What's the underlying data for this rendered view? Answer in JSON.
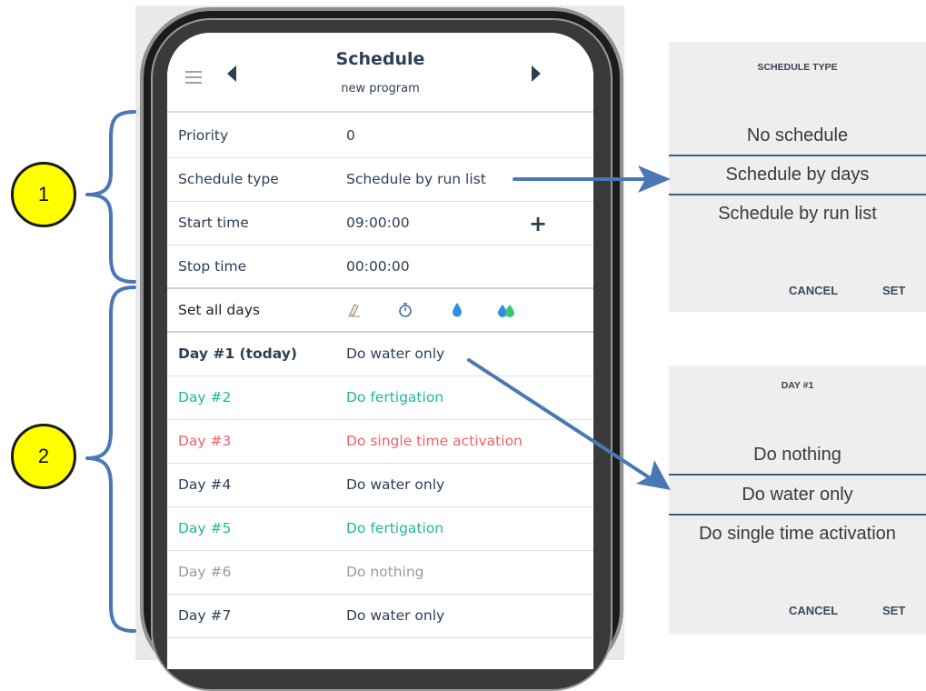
{
  "phone": {
    "header": {
      "title": "Schedule",
      "subtitle": "new program"
    },
    "settings": [
      {
        "label": "Priority",
        "value": "0"
      },
      {
        "label": "Schedule type",
        "value": "Schedule by run list"
      },
      {
        "label": "Start time",
        "value": "09:00:00",
        "action_icon": "plus-icon"
      },
      {
        "label": "Stop time",
        "value": "00:00:00"
      }
    ],
    "set_all_days": {
      "label": "Set all days",
      "icons": [
        "eraser-icon",
        "stopwatch-icon",
        "water-drop-icon",
        "fertigation-drops-icon"
      ]
    },
    "days": [
      {
        "label": "Day #1 (today)",
        "value": "Do water only",
        "color": "#2d3f55"
      },
      {
        "label": "Day #2",
        "value": "Do fertigation",
        "color": "#1fb89a"
      },
      {
        "label": "Day #3",
        "value": "Do single time activation",
        "color": "#f0606a"
      },
      {
        "label": "Day #4",
        "value": "Do water only",
        "color": "#2d3f55"
      },
      {
        "label": "Day #5",
        "value": "Do fertigation",
        "color": "#1fb89a"
      },
      {
        "label": "Day #6",
        "value": "Do nothing",
        "color": "#9a9a9a"
      },
      {
        "label": "Day #7",
        "value": "Do water only",
        "color": "#2d3f55"
      }
    ]
  },
  "schedule_type_dialog": {
    "title": "SCHEDULE TYPE",
    "options": [
      "No schedule",
      "Schedule by days",
      "Schedule by run list"
    ],
    "selected": "Schedule by days",
    "cancel_label": "CANCEL",
    "set_label": "SET"
  },
  "day_dialog": {
    "title": "DAY #1",
    "options": [
      "Do nothing",
      "Do water only",
      "Do single time activation"
    ],
    "selected": "Do water only",
    "cancel_label": "CANCEL",
    "set_label": "SET"
  },
  "callouts": [
    {
      "number": "1"
    },
    {
      "number": "2"
    }
  ],
  "colors": {
    "primary": "#2d3f55",
    "fertigation": "#1fb89a",
    "single_activation": "#f0606a",
    "nothing": "#9a9a9a",
    "arrow": "#4a78b5",
    "callout": "#ffff00"
  }
}
